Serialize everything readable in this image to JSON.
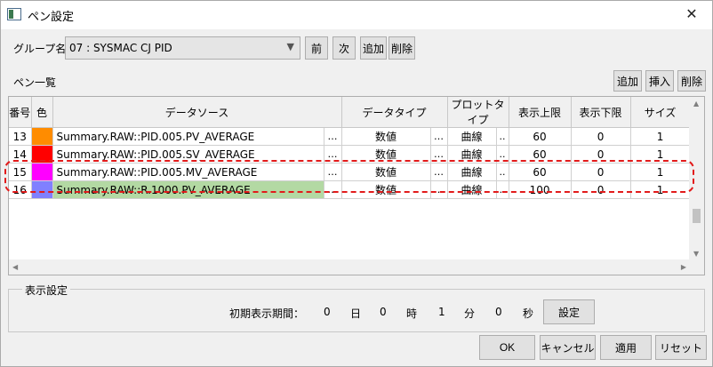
{
  "window": {
    "title": "ペン設定",
    "close_glyph": "✕"
  },
  "group": {
    "label": "グループ名",
    "value": "07 : SYSMAC CJ PID",
    "arrow": "▼",
    "prev": "前",
    "next": "次",
    "add": "追加",
    "delete": "削除"
  },
  "pens": {
    "label": "ペン一覧",
    "add": "追加",
    "insert": "挿入",
    "delete": "削除",
    "columns": [
      "番号",
      "色",
      "データソース",
      "データタイプ",
      "プロットタイプ",
      "表示上限",
      "表示下限",
      "サイズ"
    ],
    "rows": [
      {
        "no": "13",
        "color": "#ff8c00",
        "source": "Summary.RAW::PID.005.PV_AVERAGE",
        "dots1": "…",
        "dtype": "数値",
        "dots2": "…",
        "ptype": "曲線",
        "dots3": "..",
        "upper": "60",
        "lower": "0",
        "size": "1"
      },
      {
        "no": "14",
        "color": "#ff0000",
        "source": "Summary.RAW::PID.005.SV_AVERAGE",
        "dots1": "…",
        "dtype": "数値",
        "dots2": "…",
        "ptype": "曲線",
        "dots3": "..",
        "upper": "60",
        "lower": "0",
        "size": "1"
      },
      {
        "no": "15",
        "color": "#ff00ff",
        "source": "Summary.RAW::PID.005.MV_AVERAGE",
        "dots1": "…",
        "dtype": "数値",
        "dots2": "…",
        "ptype": "曲線",
        "dots3": "..",
        "upper": "60",
        "lower": "0",
        "size": "1"
      },
      {
        "no": "16",
        "color": "#8080ff",
        "source": "Summary.RAW::R.1000.PV_AVERAGE",
        "dots1": "…",
        "dtype": "数値",
        "dots2": "…",
        "ptype": "曲線",
        "dots3": "..",
        "upper": "100",
        "lower": "0",
        "size": "1",
        "selected": true
      }
    ],
    "scroll_up": "▲",
    "scroll_down": "▼",
    "scroll_left": "◀",
    "scroll_right": "▶",
    "selection_color": "#b3d9a3",
    "annotation_color": "#e21b1b"
  },
  "display": {
    "title": "表示設定",
    "initial_period_label": "初期表示期間：",
    "days": "0",
    "days_unit": "日",
    "hours": "0",
    "hours_unit": "時",
    "minutes": "1",
    "minutes_unit": "分",
    "seconds": "0",
    "seconds_unit": "秒",
    "set": "設定"
  },
  "footer": {
    "ok": "OK",
    "cancel": "キャンセル",
    "apply": "適用",
    "reset": "リセット"
  }
}
